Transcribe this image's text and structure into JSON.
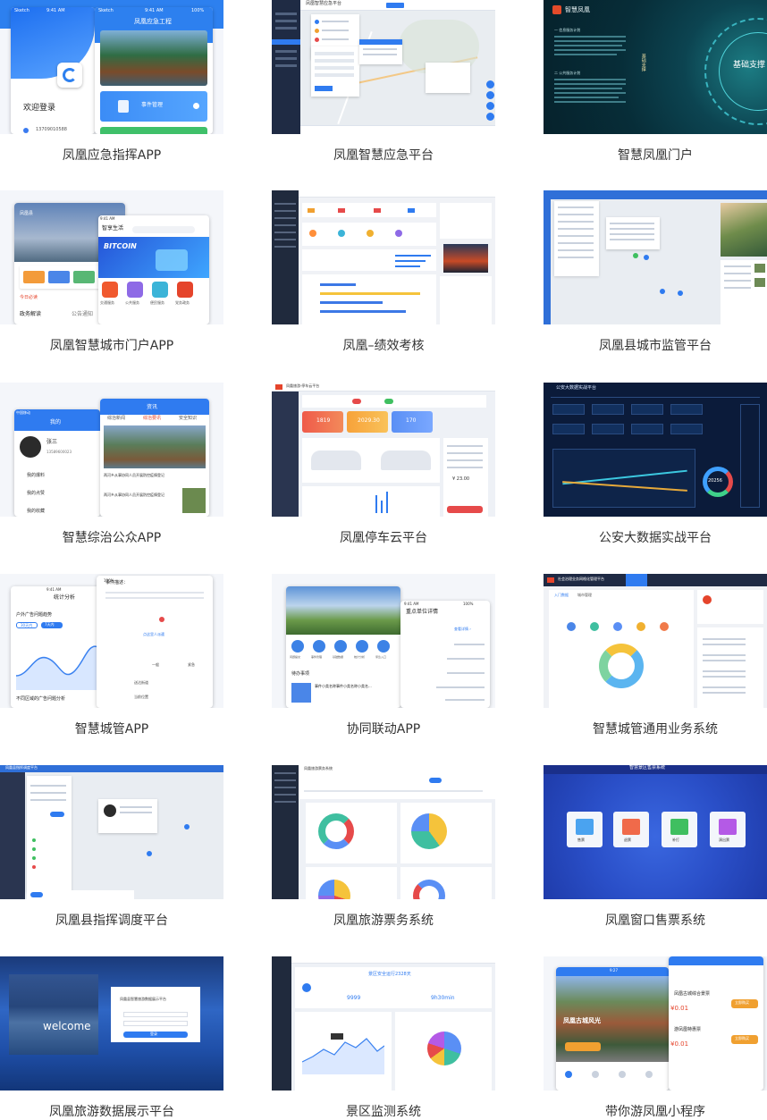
{
  "cards": [
    {
      "caption": "凤凰应急指挥APP"
    },
    {
      "caption": "凤凰智慧应急平台"
    },
    {
      "caption": "智慧凤凰门户"
    },
    {
      "caption": "凤凰智慧城市门户APP"
    },
    {
      "caption": "凤凰–绩效考核"
    },
    {
      "caption": "凤凰县城市监管平台"
    },
    {
      "caption": "智慧综治公众APP"
    },
    {
      "caption": "凤凰停车云平台"
    },
    {
      "caption": "公安大数据实战平台"
    },
    {
      "caption": "智慧城管APP"
    },
    {
      "caption": "协同联动APP"
    },
    {
      "caption": "智慧城管通用业务系统"
    },
    {
      "caption": "凤凰县指挥调度平台"
    },
    {
      "caption": "凤凰旅游票务系统"
    },
    {
      "caption": "凤凰窗口售票系统"
    },
    {
      "caption": "凤凰旅游数据展示平台"
    },
    {
      "caption": "景区监测系统"
    },
    {
      "caption": "带你游凤凰小程序"
    }
  ],
  "s1": {
    "left_status": "Sketch",
    "left_time": "9:41 AM",
    "right_status": "Sketch",
    "right_time": "9:41 AM",
    "right_battery": "100%",
    "app_title": "凤凰应急工程",
    "welcome": "欢迎登录",
    "phone": "13709010588",
    "menu_item": "事件管理"
  },
  "s2": {
    "title": "凤凰智慧应急平台"
  },
  "s3": {
    "brand": "智慧凤凰",
    "section_a": "一 信息服务计划",
    "section_b": "二 公共服务计划",
    "vertical_text": "基础支撑",
    "overlay_text": "基础支撑"
  },
  "s4": {
    "time": "9:41 AM",
    "left_title": "凤凰县",
    "right_title": "智享生活",
    "banner": "BITCOIN",
    "tab_a": "政务解读",
    "tab_b": "公告通知",
    "today": "今日必读",
    "icons": [
      "交通服务",
      "公共服务",
      "便民服务",
      "党务政务"
    ]
  },
  "s7": {
    "carrier": "中国移动",
    "time": "9:41 AM",
    "left_title": "我的",
    "right_title": "资讯",
    "name": "张三",
    "phone": "13589600023",
    "menu": [
      "我的爆料",
      "我的点赞",
      "我的收藏"
    ],
    "tabs": [
      "综治新闻",
      "综治要讯",
      "安全知识"
    ],
    "article_a": "两河乡从事协同人员开展防控疫情登记",
    "article_b": "两河乡从事协同人员开展防控疫情登记"
  },
  "s8": {
    "title": "凤凰旅游·停车云平台",
    "stat_a": "1819",
    "stat_b": "2029.30",
    "stat_c": "170",
    "price": "¥ 23.00"
  },
  "s9": {
    "title": "公安大数据实战平台",
    "ring_value": "20256"
  },
  "s10": {
    "time": "9:41 AM",
    "battery": "100%",
    "title": "统计分析",
    "chart_title": "户外广告问题趋势",
    "toggle_a": "30天内",
    "toggle_b": "7天内",
    "bottom": "不同区域的广告问题分析",
    "right_header": "事件描述：",
    "dispatch": "点这里人派遣",
    "level": "紧急",
    "opt_a": "一般",
    "addr_a": "送达街道",
    "addr_b": "当前位置"
  },
  "s11": {
    "time": "9:41 AM",
    "battery": "100%",
    "title": "重点单位详情",
    "more": "查看详情 ›",
    "icons": [
      "问题提交",
      "事件管理",
      "基础数据",
      "统计分析",
      "紧急入口"
    ],
    "todo": "待办事项",
    "item": "事件小类名称事件小类名称小类名..."
  },
  "s12": {
    "title": "社会治理业务网格化管理平台",
    "tab_a": "入门数据",
    "tab_b": "城市管理"
  },
  "s13": {
    "title": "凤凰县指挥调度平台"
  },
  "s14": {
    "title": "凤凰旅游票务系统"
  },
  "s15": {
    "title": "智慧景区售票系统",
    "buttons": [
      "售票",
      "退票",
      "补打",
      "演出票"
    ]
  },
  "s16": {
    "title": "凤凰县智慧旅游数据展示平台",
    "welcome": "welcome",
    "login": "登录"
  },
  "s17": {
    "title": "景区安全运行2328天",
    "num_a": "9999",
    "num_b": "9h30min"
  },
  "s18": {
    "time": "9:27",
    "banner": "凤凰古城风光",
    "ticket_a": "凤凰古城综合景票",
    "ticket_b": "游凤凰特惠票",
    "price": "¥0.01",
    "buy": "立即购买"
  }
}
